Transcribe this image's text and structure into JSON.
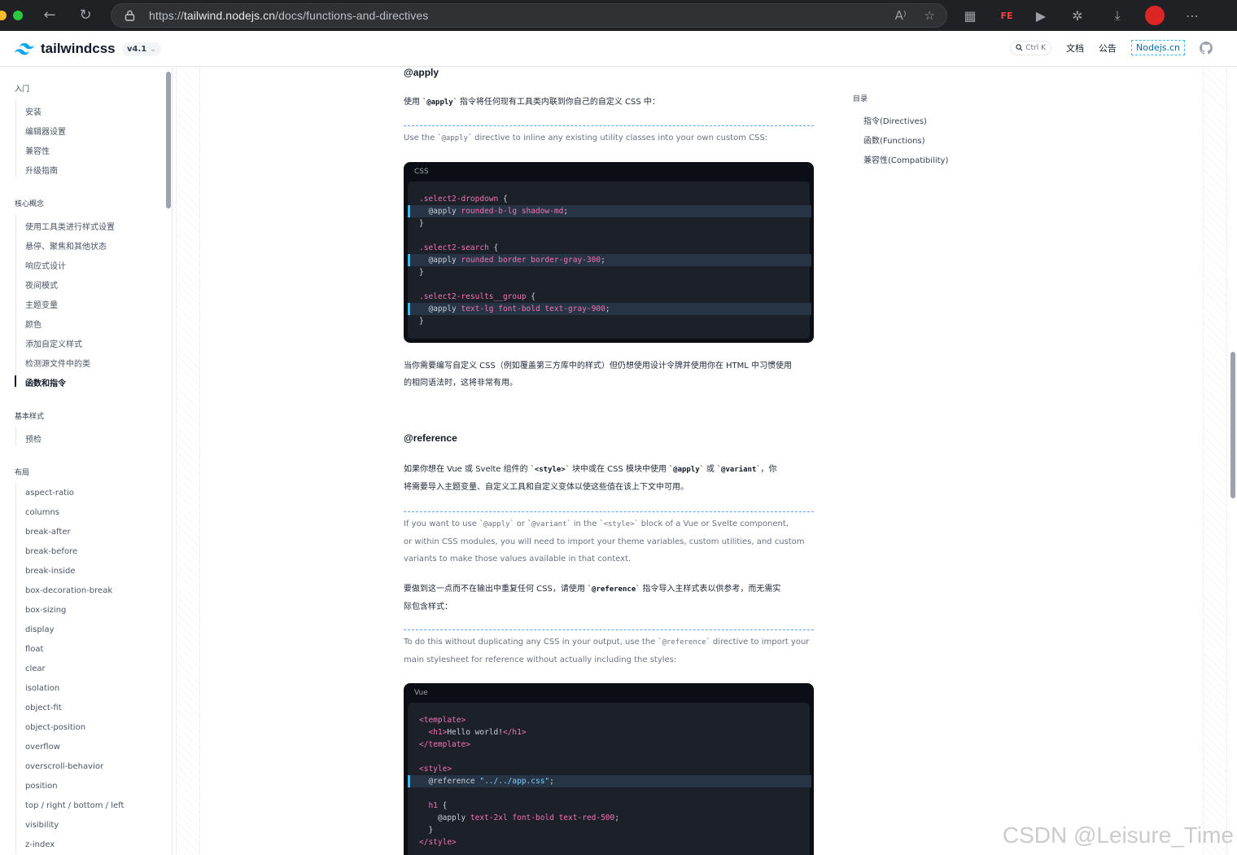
{
  "browser": {
    "url_scheme": "https://",
    "url_host": "tailwind.nodejs.cn",
    "url_path": "/docs/functions-and-directives"
  },
  "header": {
    "logo_text": "tailwindcss",
    "version": "v4.1",
    "search_shortcut": "Ctrl K",
    "links": [
      "文档",
      "公告"
    ],
    "nodejs_link": "Nodejs.cn"
  },
  "sidebar": {
    "sections": [
      {
        "title": "入门",
        "items": [
          "安装",
          "编辑器设置",
          "兼容性",
          "升级指南"
        ]
      },
      {
        "title": "核心概念",
        "items": [
          "使用工具类进行样式设置",
          "悬停、聚焦和其他状态",
          "响应式设计",
          "夜间模式",
          "主题变量",
          "颜色",
          "添加自定义样式",
          "检测源文件中的类",
          "函数和指令"
        ]
      },
      {
        "title": "基本样式",
        "items": [
          "预检"
        ]
      },
      {
        "title": "布局",
        "items": [
          "aspect-ratio",
          "columns",
          "break-after",
          "break-before",
          "break-inside",
          "box-decoration-break",
          "box-sizing",
          "display",
          "float",
          "clear",
          "isolation",
          "object-fit",
          "object-position",
          "overflow",
          "overscroll-behavior",
          "position",
          "top / right / bottom / left",
          "visibility",
          "z-index"
        ]
      }
    ],
    "active_item": "函数和指令"
  },
  "content": {
    "apply_heading": "@apply",
    "apply_para_pre": "使用 `",
    "apply_para_code": "@apply",
    "apply_para_post": "` 指令将任何现有工具类内联到你自己的自定义 CSS 中：",
    "apply_trans_pre": "Use the `",
    "apply_trans_code": "@apply",
    "apply_trans_post": "` directive to inline any existing utility classes into your own custom CSS:",
    "code1_lang": "CSS",
    "code1_lines": [
      {
        "sel": ".select2-dropdown",
        "rest": " {"
      },
      {
        "kw": "  @apply",
        "val": " rounded-b-lg shadow-md",
        "rest": ";",
        "hl": true
      },
      {
        "rest": "}"
      },
      {
        "rest": ""
      },
      {
        "sel": ".select2-search",
        "rest": " {"
      },
      {
        "kw": "  @apply",
        "val": " rounded border border-gray-300",
        "rest": ";",
        "hl": true
      },
      {
        "rest": "}"
      },
      {
        "rest": ""
      },
      {
        "sel": ".select2-results__group",
        "rest": " {"
      },
      {
        "kw": "  @apply",
        "val": " text-lg font-bold text-gray-900",
        "rest": ";",
        "hl": true
      },
      {
        "rest": "}"
      }
    ],
    "apply_after_1": "当你需要编写自定义 CSS（例如覆盖第三方库中的样式）但仍想使用设计令牌并使用你在 HTML 中习惯使用",
    "apply_after_2": "的相同语法时，这将非常有用。",
    "ref_heading": "@reference",
    "ref_para_1_pre": "如果你想在 Vue 或 Svelte 组件的 `",
    "ref_para_1_c1": "<style>",
    "ref_para_1_mid": "` 块中或在 CSS 模块中使用 `",
    "ref_para_1_c2": "@apply",
    "ref_para_1_mid2": "` 或 `",
    "ref_para_1_c3": "@variant",
    "ref_para_1_post": "`，你",
    "ref_para_2": "将需要导入主题变量、自定义工具和自定义变体以使这些值在该上下文中可用。",
    "ref_trans_1_pre": "If you want to use `",
    "ref_trans_1_c1": "@apply",
    "ref_trans_1_mid": "` or `",
    "ref_trans_1_c2": "@variant",
    "ref_trans_1_mid2": "` in the `",
    "ref_trans_1_c3": "<style>",
    "ref_trans_1_post": "` block of a Vue or Svelte component,",
    "ref_trans_2": "or within CSS modules, you will need to import your theme variables, custom utilities, and custom",
    "ref_trans_3": "variants to make those values available in that context.",
    "ref2_para_1_pre": "要做到这一点而不在输出中重复任何 CSS，请使用 `",
    "ref2_para_1_code": "@reference",
    "ref2_para_1_post": "` 指令导入主样式表以供参考，而无需实",
    "ref2_para_2": "际包含样式：",
    "ref2_trans_1_pre": "To do this without duplicating any CSS in your output, use the `",
    "ref2_trans_1_code": "@reference",
    "ref2_trans_1_post": "` directive to import your",
    "ref2_trans_2": "main stylesheet for reference without actually including the styles:",
    "code2_lang": "Vue",
    "code2_lines": [
      {
        "t1": "<template>"
      },
      {
        "t2a": "  <h1>",
        "t2b": "Hello world!",
        "t2c": "</h1>"
      },
      {
        "t1": "</template>"
      },
      {
        "blank": ""
      },
      {
        "t1": "<style>"
      },
      {
        "kw": "  @reference",
        "str": " \"../../app.css\"",
        "rest": ";",
        "hl": true
      },
      {
        "blank": ""
      },
      {
        "sel": "  h1",
        "rest": " {"
      },
      {
        "kw": "    @apply",
        "val": " text-2xl font-bold text-red-500",
        "rest": ";"
      },
      {
        "rest": "  }"
      },
      {
        "t1": "</style>"
      }
    ]
  },
  "toc": {
    "title": "目录",
    "items": [
      "指令(Directives)",
      "函数(Functions)",
      "兼容性(Compatibility)"
    ]
  },
  "watermark": "CSDN @Leisure_Time",
  "colors": {
    "accent": "#38bdf8",
    "code_bg": "#0b0e14",
    "pink": "#f472b6"
  }
}
